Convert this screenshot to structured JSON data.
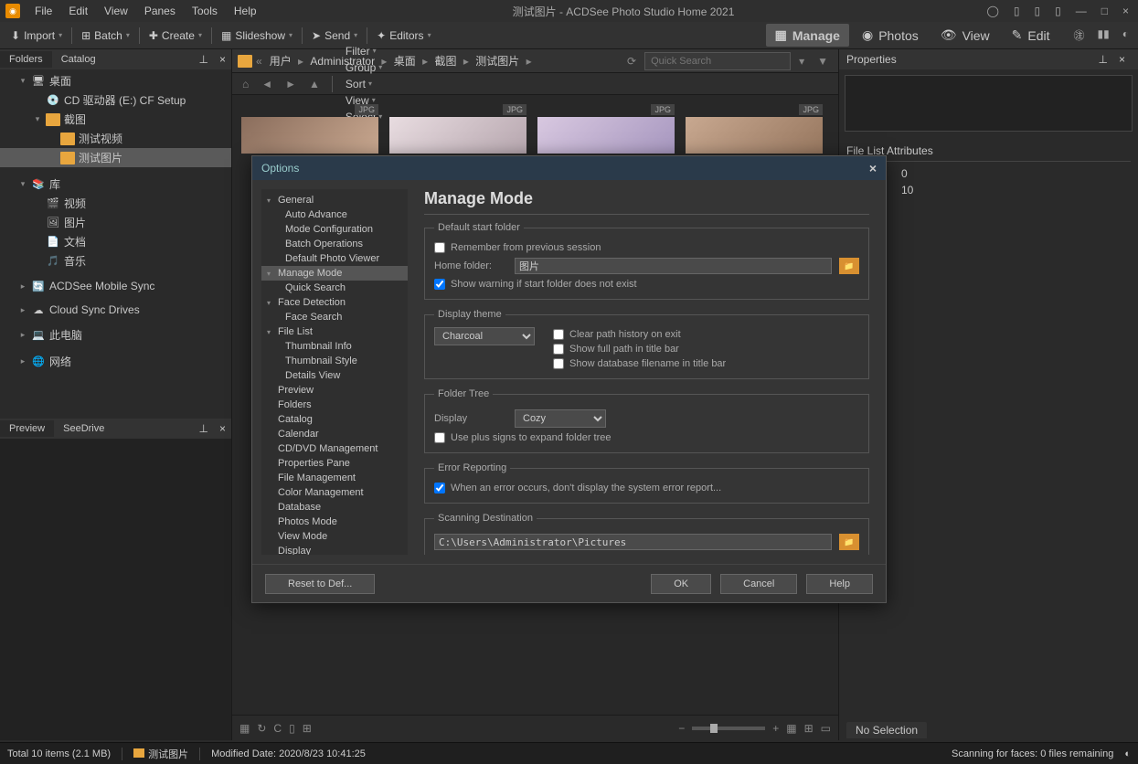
{
  "title": "测试图片 - ACDSee Photo Studio Home 2021",
  "menu": [
    "File",
    "Edit",
    "View",
    "Panes",
    "Tools",
    "Help"
  ],
  "toolbar": {
    "import": "Import",
    "batch": "Batch",
    "create": "Create",
    "slideshow": "Slideshow",
    "send": "Send",
    "editors": "Editors"
  },
  "modes": {
    "manage": "Manage",
    "photos": "Photos",
    "view": "View",
    "edit": "Edit"
  },
  "left": {
    "tabs": {
      "folders": "Folders",
      "catalog": "Catalog",
      "preview": "Preview",
      "seedrive": "SeeDrive"
    },
    "tree": [
      {
        "l": "桌面",
        "d": 1,
        "exp": true,
        "ic": "desk"
      },
      {
        "l": "CD 驱动器 (E:) CF Setup",
        "d": 2,
        "ic": "cd"
      },
      {
        "l": "截图",
        "d": 2,
        "exp": true,
        "ic": "fld"
      },
      {
        "l": "测试视频",
        "d": 3,
        "ic": "fld"
      },
      {
        "l": "测试图片",
        "d": 3,
        "ic": "fld",
        "sel": true
      },
      {
        "l": "",
        "d": 0,
        "spacer": true
      },
      {
        "l": "库",
        "d": 1,
        "exp": true,
        "ic": "lib"
      },
      {
        "l": "视频",
        "d": 2,
        "ic": "vid"
      },
      {
        "l": "图片",
        "d": 2,
        "ic": "pic"
      },
      {
        "l": "文档",
        "d": 2,
        "ic": "doc"
      },
      {
        "l": "音乐",
        "d": 2,
        "ic": "mus"
      },
      {
        "l": "",
        "d": 0,
        "spacer": true
      },
      {
        "l": "ACDSee Mobile Sync",
        "d": 1,
        "ic": "sync"
      },
      {
        "l": "",
        "d": 0,
        "spacer": true
      },
      {
        "l": "Cloud Sync Drives",
        "d": 1,
        "ic": "cloud"
      },
      {
        "l": "",
        "d": 0,
        "spacer": true
      },
      {
        "l": "此电脑",
        "d": 1,
        "ic": "pc"
      },
      {
        "l": "",
        "d": 0,
        "spacer": true
      },
      {
        "l": "网络",
        "d": 1,
        "ic": "net"
      }
    ]
  },
  "path": [
    "用户",
    "Administrator",
    "桌面",
    "截图",
    "测试图片"
  ],
  "search_placeholder": "Quick Search",
  "filter_menus": [
    "Filter",
    "Group",
    "Sort",
    "View",
    "Select"
  ],
  "thumb_badge": "JPG",
  "right": {
    "header": "Properties",
    "fla": "File List Attributes",
    "attrs": [
      {
        "v": "0"
      },
      {
        "v": "10"
      }
    ],
    "nosel": "No Selection"
  },
  "status": {
    "total": "Total 10 items  (2.1 MB)",
    "folder": "测试图片",
    "modified": "Modified Date: 2020/8/23 10:41:25",
    "faces": "Scanning for faces: 0 files remaining"
  },
  "dialog": {
    "title": "Options",
    "tree": [
      {
        "l": "General",
        "h": true
      },
      {
        "l": "Auto Advance",
        "s": true
      },
      {
        "l": "Mode Configuration",
        "s": true
      },
      {
        "l": "Batch Operations",
        "s": true
      },
      {
        "l": "Default Photo Viewer",
        "s": true
      },
      {
        "l": "Manage Mode",
        "h": true,
        "sel": true
      },
      {
        "l": "Quick Search",
        "s": true
      },
      {
        "l": "Face Detection",
        "h": true
      },
      {
        "l": "Face Search",
        "s": true
      },
      {
        "l": "File List",
        "h": true
      },
      {
        "l": "Thumbnail Info",
        "s": true
      },
      {
        "l": "Thumbnail Style",
        "s": true
      },
      {
        "l": "Details View",
        "s": true
      },
      {
        "l": "Preview"
      },
      {
        "l": "Folders"
      },
      {
        "l": "Catalog"
      },
      {
        "l": "Calendar"
      },
      {
        "l": "CD/DVD Management"
      },
      {
        "l": "Properties Pane"
      },
      {
        "l": "File Management"
      },
      {
        "l": "Color Management"
      },
      {
        "l": "Database"
      },
      {
        "l": "Photos Mode"
      },
      {
        "l": "View Mode"
      },
      {
        "l": "Display"
      }
    ],
    "heading": "Manage Mode",
    "g_start": "Default start folder",
    "remember": "Remember from previous session",
    "home_label": "Home folder:",
    "home_value": "图片",
    "warn": "Show warning if start folder does not exist",
    "g_theme": "Display theme",
    "theme_value": "Charcoal",
    "clear_hist": "Clear path history on exit",
    "full_path": "Show full path in title bar",
    "db_name": "Show database filename in title bar",
    "g_folder": "Folder Tree",
    "disp_label": "Display",
    "disp_value": "Cozy",
    "plus": "Use plus signs to expand folder tree",
    "g_error": "Error Reporting",
    "err_chk": "When an error occurs, don't display the system error report...",
    "g_scan": "Scanning Destination",
    "scan_value": "C:\\Users\\Administrator\\Pictures",
    "reset": "Reset to Def...",
    "ok": "OK",
    "cancel": "Cancel",
    "help": "Help"
  }
}
